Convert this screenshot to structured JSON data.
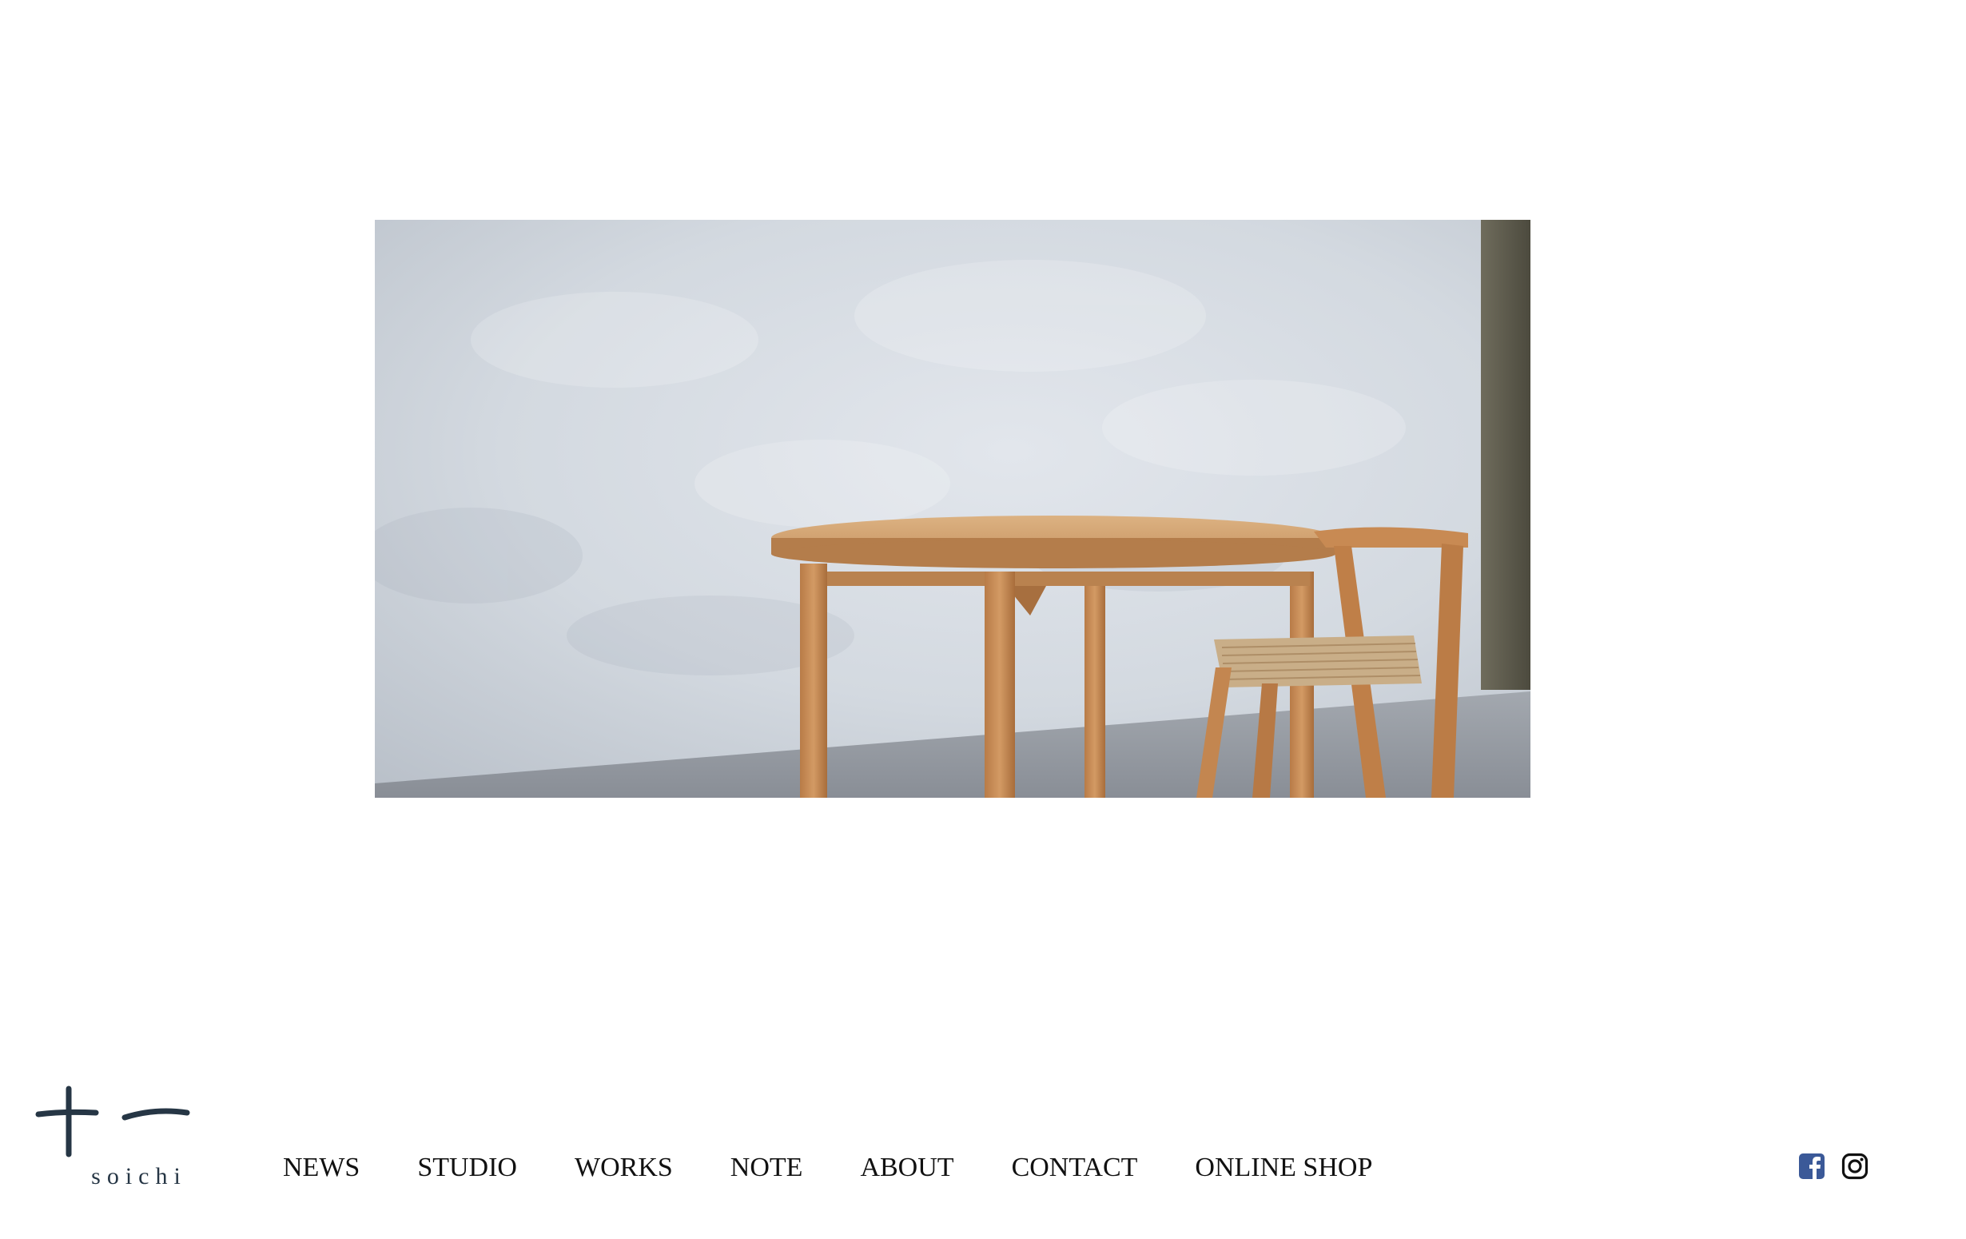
{
  "hero": {
    "alt": "",
    "colors": {
      "wall": "#d5dbe2",
      "floor": "#8f969e",
      "wood": "#c48a56",
      "column": "#5e5c4e"
    }
  },
  "logo": {
    "mark": "十一",
    "text": "soichi",
    "color": "#263645"
  },
  "nav": {
    "items": [
      {
        "label": "NEWS"
      },
      {
        "label": "STUDIO"
      },
      {
        "label": "WORKS"
      },
      {
        "label": "NOTE"
      },
      {
        "label": "ABOUT"
      },
      {
        "label": "CONTACT"
      },
      {
        "label": "ONLINE SHOP"
      }
    ]
  },
  "social": {
    "facebook": {
      "icon": "facebook-icon",
      "color": "#3b5998"
    },
    "instagram": {
      "icon": "instagram-icon",
      "color": "#111111"
    }
  }
}
